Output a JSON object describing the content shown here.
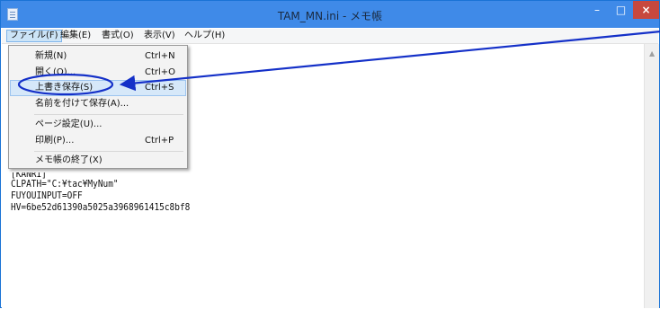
{
  "window": {
    "title": "TAM_MN.ini - メモ帳",
    "min_glyph": "–",
    "max_glyph": "□",
    "close_glyph": "×"
  },
  "menubar": {
    "items": [
      {
        "label": "ファイル(F)"
      },
      {
        "label": "編集(E)"
      },
      {
        "label": "書式(O)"
      },
      {
        "label": "表示(V)"
      },
      {
        "label": "ヘルプ(H)"
      }
    ]
  },
  "file_menu": {
    "items": [
      {
        "label": "新規(N)",
        "shortcut": "Ctrl+N"
      },
      {
        "label": "開く(O)...",
        "shortcut": "Ctrl+O"
      },
      {
        "label": "上書き保存(S)",
        "shortcut": "Ctrl+S"
      },
      {
        "label": "名前を付けて保存(A)...",
        "shortcut": ""
      },
      {
        "label": "ページ設定(U)...",
        "shortcut": ""
      },
      {
        "label": "印刷(P)...",
        "shortcut": "Ctrl+P"
      },
      {
        "label": "メモ帳の終了(X)",
        "shortcut": ""
      }
    ],
    "highlighted_item": "上書き保存(S)"
  },
  "editor": {
    "lines": [
      "[KANRI]",
      "CLPATH=\"C:¥tac¥MyNum\"",
      "FUYOUINPUT=OFF",
      "HV=6be52d61390a5025a3968961415c8bf8"
    ]
  },
  "annotation": {
    "color": "#1430c8"
  }
}
